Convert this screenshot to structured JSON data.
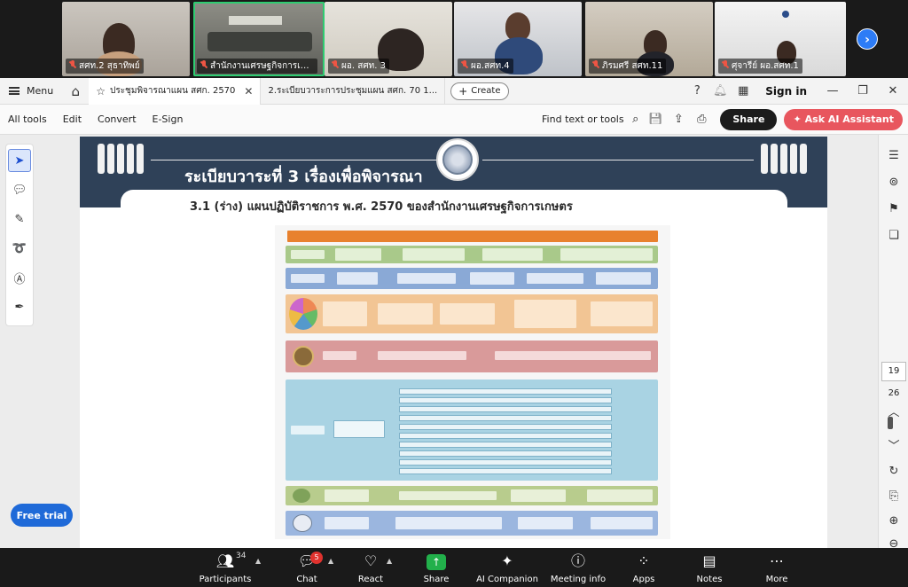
{
  "zoom": {
    "participants": [
      {
        "name": "สศท.2 สุธาทิพย์"
      },
      {
        "name": "สำนักงานเศรษฐกิจการเกษตร (ห้..."
      },
      {
        "name": "ผอ. สศท. 3"
      },
      {
        "name": "ผอ.สศท.4"
      },
      {
        "name": "ภิรมศรี สศท.11"
      },
      {
        "name": "ศุจารีย์ ผอ.สศท.1"
      }
    ],
    "controls": {
      "participants_label": "Participants",
      "participants_count": "34",
      "chat_label": "Chat",
      "chat_badge": "5",
      "react_label": "React",
      "share_label": "Share",
      "ai_label": "AI Companion",
      "meeting_info_label": "Meeting info",
      "apps_label": "Apps",
      "notes_label": "Notes",
      "more_label": "More"
    }
  },
  "acrobat": {
    "menu_label": "Menu",
    "tabs": [
      {
        "label": "ประชุมพิจารณาแผน สศก. 2570"
      },
      {
        "label": "2.ระเบียบวาระการประชุมแผน สศก. 70  1..."
      }
    ],
    "create_label": "Create",
    "signin_label": "Sign in",
    "toolbar": {
      "all_tools": "All tools",
      "edit": "Edit",
      "convert": "Convert",
      "esign": "E-Sign",
      "find": "Find text or tools",
      "share": "Share",
      "ask_ai": "Ask AI Assistant"
    },
    "free_trial": "Free trial",
    "page_current": "19",
    "page_total": "26"
  },
  "slide": {
    "title": "ระเบียบวาระที่ 3 เรื่องเพื่อพิจารณา",
    "subtitle": "3.1 (ร่าง) แผนปฏิบัติราชการ พ.ศ. 2570 ของสำนักงานเศรษฐกิจการเกษตร"
  },
  "colors": {
    "slide_header": "#2f4158",
    "row_green": "#a9c98a",
    "row_blue": "#8aa9d6",
    "row_orange": "#f2c594",
    "row_red": "#d99a9a",
    "row_teal": "#a9d3e3",
    "row_olive": "#b8cc8d",
    "row_lblue": "#9bb6df"
  }
}
